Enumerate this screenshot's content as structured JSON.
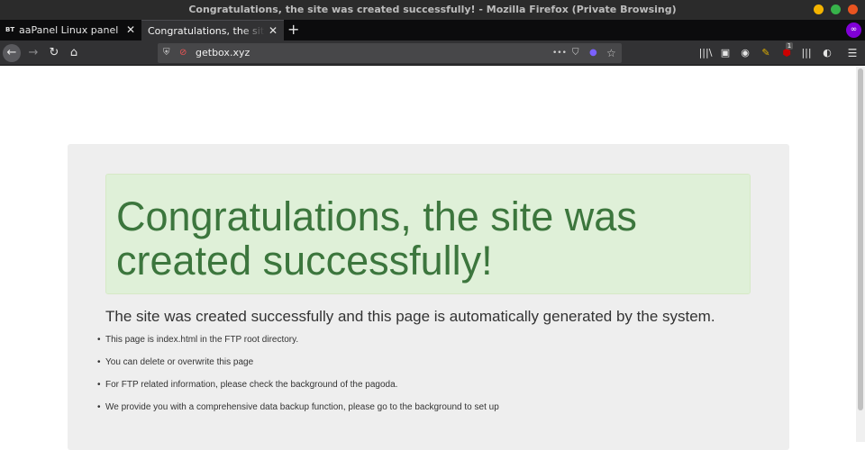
{
  "window": {
    "title": "Congratulations, the site was created successfully! - Mozilla Firefox (Private Browsing)",
    "colors": {
      "close": "#e95420",
      "minimize": "#f4b400",
      "maximize": "#37b34a",
      "private": "#8000d7"
    }
  },
  "tabs": [
    {
      "favicon": "BT",
      "label": "aaPanel Linux panel",
      "close": "✕",
      "active": false
    },
    {
      "favicon": "",
      "label": "Congratulations, the site was created successfully!",
      "close": "✕",
      "active": true
    }
  ],
  "new_tab": "+",
  "toolbar": {
    "back": "←",
    "forward": "→",
    "reload": "↻",
    "home": "⌂",
    "url": "getbox.xyz",
    "page_actions": "•••",
    "menu": "☰"
  },
  "page": {
    "heading": "Congratulations, the site was created successfully!",
    "description": "The site was created successfully and this page is automatically generated by the system.",
    "bullets": [
      "This page is index.html in the FTP root directory.",
      "You can delete or overwrite this page",
      "For FTP related information, please check the background of the pagoda.",
      "We provide you with a comprehensive data backup function, please go to the background to set up"
    ]
  },
  "extensions": {
    "badge_count": "1"
  }
}
